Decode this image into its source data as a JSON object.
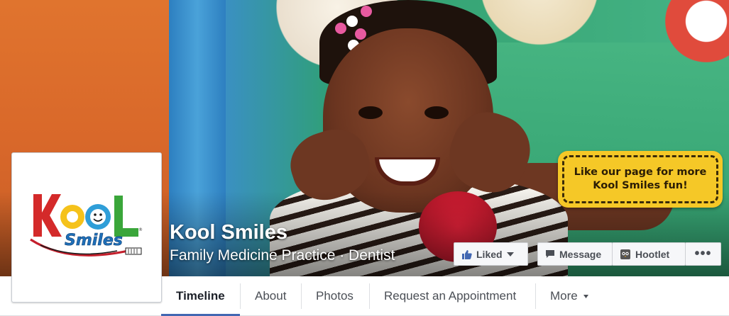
{
  "page": {
    "name": "Kool Smiles",
    "category": "Family Medicine Practice · Dentist"
  },
  "cover": {
    "promo_line1": "Like our page for more",
    "promo_line2": "Kool Smiles fun!"
  },
  "logo": {
    "brand_text": "KOOL Smiles"
  },
  "actions": {
    "liked_label": "Liked",
    "message_label": "Message",
    "hootlet_label": "Hootlet",
    "more_label": "•••"
  },
  "nav": {
    "tabs": [
      {
        "label": "Timeline",
        "active": true
      },
      {
        "label": "About"
      },
      {
        "label": "Photos"
      },
      {
        "label": "Request an Appointment"
      },
      {
        "label": "More"
      }
    ]
  },
  "icons": {
    "liked": "thumbs-up-icon",
    "liked_caret": "caret-down-icon",
    "message": "speech-bubble-icon",
    "hootlet": "owl-icon",
    "more_caret": "caret-down-icon"
  },
  "colors": {
    "accent": "#4267b2",
    "promo_bg": "#f5c827"
  }
}
